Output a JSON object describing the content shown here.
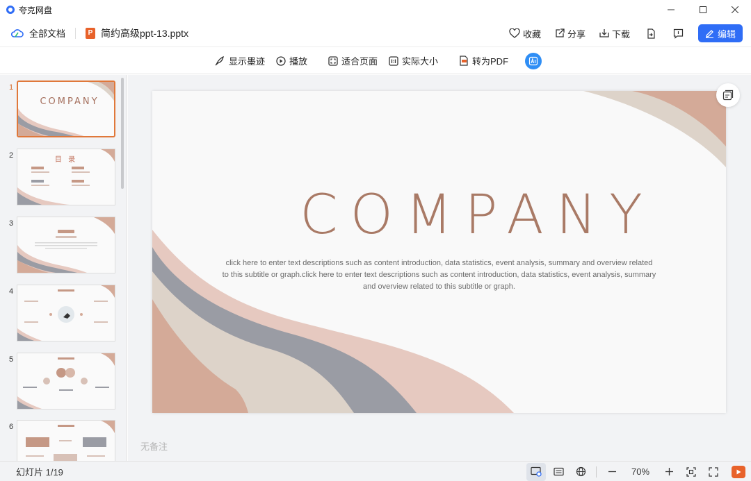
{
  "app": {
    "title": "夸克网盘"
  },
  "header": {
    "all_docs": "全部文档",
    "file_name": "简约高级ppt-13.pptx",
    "file_icon": "P",
    "favorite": "收藏",
    "share": "分享",
    "download": "下载",
    "edit": "编辑"
  },
  "toolbar": {
    "show_ink": "显示墨迹",
    "play": "播放",
    "fit_page": "适合页面",
    "actual_size": "实际大小",
    "to_pdf": "转为PDF"
  },
  "sidebar": {
    "thumbs": [
      {
        "num": "1",
        "title": "COMPANY"
      },
      {
        "num": "2",
        "title": "目 录"
      },
      {
        "num": "3",
        "title": ""
      },
      {
        "num": "4",
        "title": ""
      },
      {
        "num": "5",
        "title": ""
      },
      {
        "num": "6",
        "title": ""
      }
    ]
  },
  "slide": {
    "title": "COMPANY",
    "description": "click here to enter text descriptions such as content introduction, data statistics, event analysis, summary and overview related to this subtitle or graph.click here to enter text descriptions such as content introduction, data statistics, event analysis, summary and overview related to this subtitle or graph."
  },
  "notes": {
    "placeholder": "无备注"
  },
  "status": {
    "slide_count": "幻灯片 1/19",
    "zoom": "70%"
  },
  "colors": {
    "accent": "#2f6df6",
    "title_color": "#a97a66",
    "wave_pink": "#e6c9c0",
    "wave_tan": "#d4aa98",
    "wave_grey": "#9a9ca4",
    "wave_beige": "#ddd3c9",
    "play_orange": "#e8622a"
  },
  "icons": [
    "cloud-icon",
    "ppt-file-icon",
    "heart-icon",
    "share-icon",
    "download-icon",
    "export-icon",
    "comment-icon",
    "pen-icon",
    "ink-icon",
    "play-icon",
    "fit-page-icon",
    "actual-size-icon",
    "pdf-icon",
    "ai-icon",
    "gallery-icon",
    "note-view-icon",
    "web-icon",
    "zoom-out-icon",
    "zoom-in-icon",
    "fit-icon",
    "fullscreen-icon",
    "slideshow-icon"
  ]
}
